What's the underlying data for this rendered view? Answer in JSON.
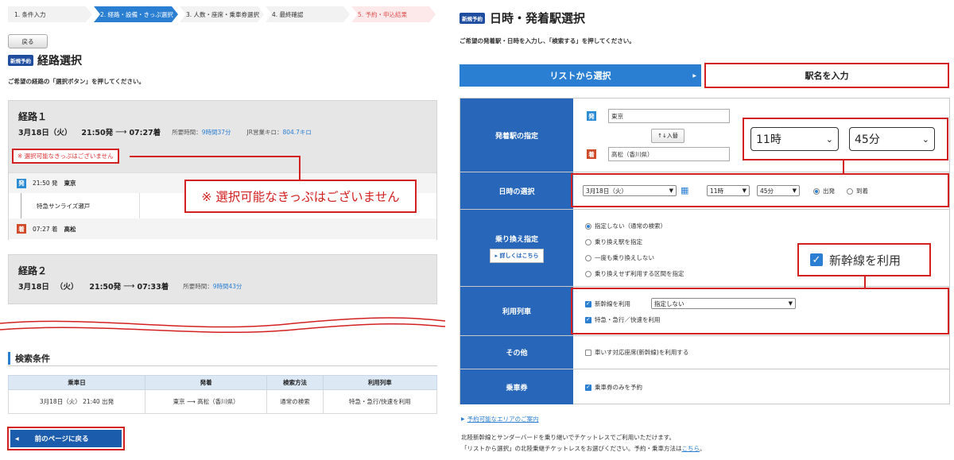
{
  "left": {
    "steps": [
      {
        "label": "1. 条件入力"
      },
      {
        "label": "2. 経路・設備・きっぷ選択"
      },
      {
        "label": "3. 人数・座席・乗車券選択"
      },
      {
        "label": "4. 最終確認"
      },
      {
        "label": "5. 予約・申込結果"
      }
    ],
    "back_label": "戻る",
    "tag": "新規予約",
    "title": "経路選択",
    "desc": "ご希望の経路の「選択ボタン」を押してください。",
    "route1": {
      "name": "経路１",
      "date": "3月18日（火）",
      "dep_time": "21:50発",
      "arr_time": "07:27着",
      "duration_label": "所要時間：",
      "duration": "9時間37分",
      "distance_label": "JR営業キロ：",
      "distance": "804.7キロ",
      "warning": "※ 選択可能なきっぷはございません",
      "dep_badge": "発",
      "dep_station_time": "21:50 発",
      "dep_station": "東京",
      "train": "特急サンライズ瀬戸",
      "arr_badge": "着",
      "arr_station_time": "07:27 着",
      "arr_station": "高松"
    },
    "callout": "※ 選択可能なきっぷはございません",
    "route2": {
      "name": "経路２",
      "date": "3月18日",
      "dow": "（火）",
      "dep_time": "21:50発",
      "arr_time": "07:33着",
      "duration_label": "所要時間：",
      "duration": "9時間43分"
    },
    "cond_title": "検索条件",
    "cond_headers": [
      "乗車日",
      "発着",
      "検索方法",
      "利用列車"
    ],
    "cond_row": {
      "date": "3月18日（火） 21:40 出発",
      "from": "東京",
      "to": "高松（香川県）",
      "method": "通常の検索",
      "trains": "特急・急行/快速を利用"
    },
    "prev_label": "前のページに戻る"
  },
  "right": {
    "tag": "新規予約",
    "title": "日時・発着駅選択",
    "desc": "ご希望の発着駅・日時を入力し、「検索する」を押してください。",
    "tab_list": "リストから選択",
    "tab_name": "駅名を入力",
    "rows": {
      "station_label": "発着駅の指定",
      "dep_badge": "発",
      "dep_value": "東京",
      "swap_label": "↑↓入替",
      "arr_badge": "着",
      "arr_value": "高松（香川県）",
      "big_hour": "11時",
      "big_min": "45分",
      "datetime_label": "日時の選択",
      "date_value": "3月18日（火）",
      "hour_value": "11時",
      "min_value": "45分",
      "dep_radio": "出発",
      "arr_radio": "到着",
      "transfer_label": "乗り換え指定",
      "detail_label": "▸ 詳しくはこちら",
      "transfer_opts": [
        "指定しない（通常の検索）",
        "乗り換え駅を指定",
        "一度も乗り換えしない",
        "乗り換えせず利用する区間を指定"
      ],
      "shinkansen_callout": "新幹線を利用",
      "trains_label": "利用列車",
      "shinkansen_opt": "新幹線を利用",
      "shinkansen_select": "指定しない",
      "express_opt": "特急・急行／快速を利用",
      "other_label": "その他",
      "wheelchair_opt": "車いす対応座席(新幹線)を利用する",
      "ticket_label": "乗車券",
      "ticket_opt": "乗車券のみを予約"
    },
    "area_link": "予約可能なエリアのご案内",
    "foot1": "北陸新幹線とサンダーバードを乗り継いでチケットレスでご利用いただけます。",
    "foot2": "「リストから選択」の北陸乗継チケットレスをお選びください。予約・乗車方法は",
    "foot2_link": "こちら",
    "foot2_end": "。"
  },
  "colors": {
    "accent": "#2b7fd3",
    "header_blue": "#2766b8",
    "highlight": "#d32020"
  }
}
